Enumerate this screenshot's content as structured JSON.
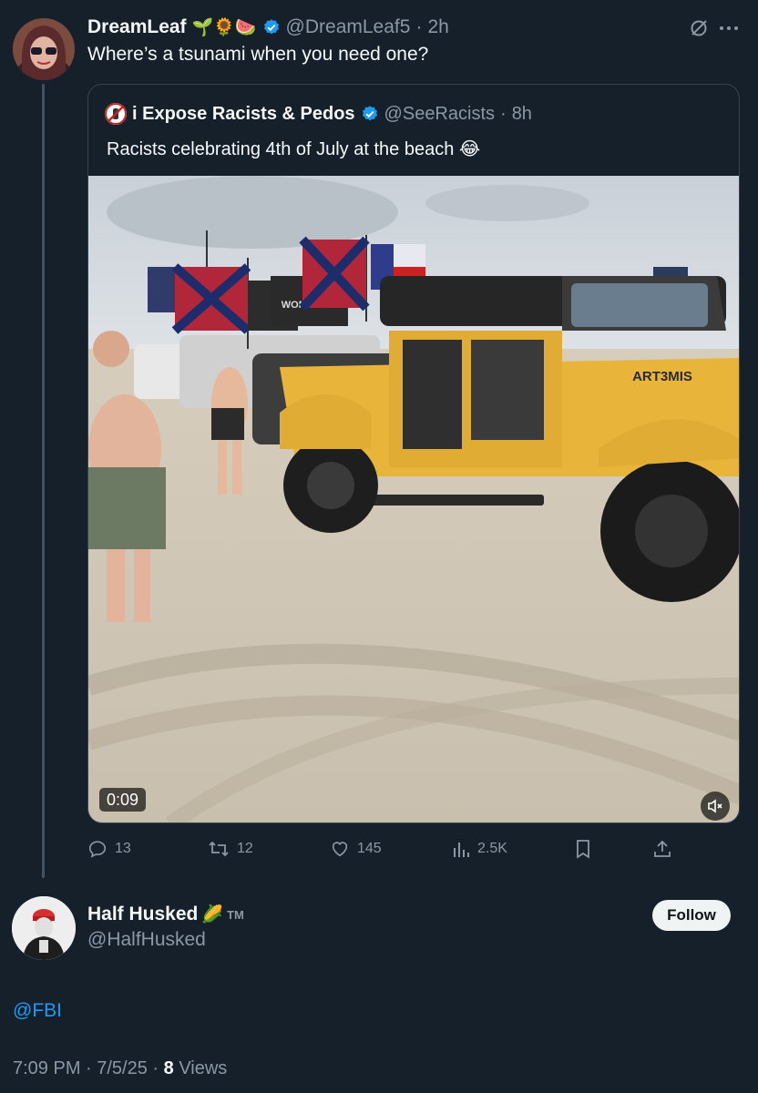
{
  "tweet": {
    "author_name": "DreamLeaf",
    "author_emojis": "🌱🌻🍉",
    "handle": "@DreamLeaf5",
    "time": "2h",
    "text": "Where’s a tsunami when you need one?"
  },
  "quoted": {
    "author_name": "i Expose Racists & Pedos",
    "handle": "@SeeRacists",
    "time": "8h",
    "text": "Racists celebrating 4th of July at the beach 😂",
    "video": {
      "duration": "0:09",
      "jeep_text": "ART3MIS",
      "flag_text": "WONETING"
    }
  },
  "actions": {
    "replies": "13",
    "reposts": "12",
    "likes": "145",
    "views": "2.5K"
  },
  "reply": {
    "author_name": "Half Husked",
    "author_emoji": "🌽",
    "trademark": "TM",
    "handle": "@HalfHusked",
    "follow_label": "Follow",
    "text": "@FBI",
    "timestamp": "7:09 PM · 7/5/25 · ",
    "views_count": "8",
    "views_label": " Views"
  },
  "colors": {
    "background": "#15202b",
    "text": "#f7f9f9",
    "muted": "#8b98a5",
    "link": "#1d9bf0",
    "jeep": "#e8b53a"
  },
  "icons": [
    "sprout-icon",
    "sunflower-icon",
    "watermelon-icon",
    "verified-badge-icon",
    "grok-icon",
    "more-icon",
    "reply-icon",
    "repost-icon",
    "like-icon",
    "views-icon",
    "bookmark-icon",
    "share-icon",
    "mute-icon"
  ]
}
